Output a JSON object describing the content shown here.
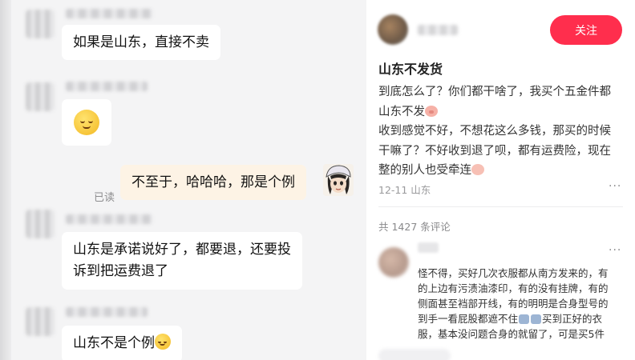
{
  "chat": {
    "messages": [
      {
        "text": "如果是山东，直接不卖"
      },
      {
        "emoji": "relieved-face"
      },
      {
        "text": "不至于，哈哈哈，那是个例",
        "status": "已读"
      },
      {
        "line1": "山东是承诺说好了，都要退，还要投",
        "line2": "诉到把运费退了"
      },
      {
        "text": "山东不是个例"
      }
    ]
  },
  "post": {
    "follow_label": "关注",
    "title": "山东不发货",
    "body_lines": [
      "到底怎么了？你们都干啥了，我买个五金件都",
      "山东不发",
      "收到感觉不好，不想花这么多钱，那买的时候",
      "干嘛了？不好收到退了呗，都有运费险，现在",
      "整的别人也受牵连"
    ],
    "meta": "12-11 山东",
    "more": "···",
    "comment_count": "共 1427 条评论"
  },
  "comment": {
    "more": "···",
    "lines": [
      "怪不得，买好几次衣服都从南方发来的，有",
      "的上边有污渍油漆印，有的没有挂牌，有的",
      "侧面甚至裆部开线，有的明明是合身型号的",
      "到手一看屁股都遮不住",
      "买到正好的衣",
      "服，基本没问题合身的就留了，可是买5件"
    ]
  },
  "colors": {
    "follow_button": "#ff2e4d",
    "my_bubble": "#fdf3e5",
    "chat_background": "#f4f4f5"
  }
}
